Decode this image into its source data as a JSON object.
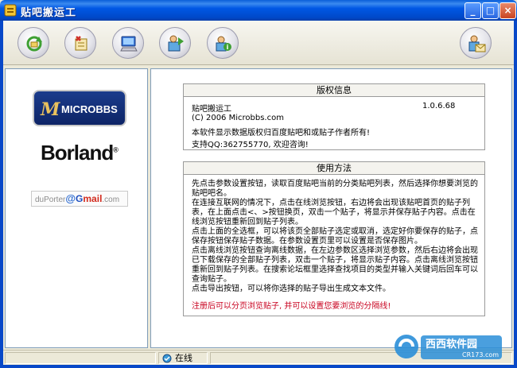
{
  "window": {
    "title": "贴吧搬运工",
    "minimize_symbol": "_",
    "maximize_symbol": "□",
    "close_symbol": "×"
  },
  "toolbar": {
    "buttons": [
      {
        "name": "refresh-button",
        "icon": "refresh-icon"
      },
      {
        "name": "delete-button",
        "icon": "delete-icon"
      },
      {
        "name": "computer-button",
        "icon": "computer-icon"
      },
      {
        "name": "export-button",
        "icon": "export-icon"
      },
      {
        "name": "info-button",
        "icon": "info-icon"
      },
      {
        "name": "contact-button",
        "icon": "user-mail-icon"
      }
    ]
  },
  "left_panel": {
    "microbbs_mark": "M",
    "microbbs_word": "MICROBBS",
    "borland": "Borland",
    "borland_reg": "®",
    "gmail_user": "duPorter",
    "gmail_at": "@",
    "gmail_g": "G",
    "gmail_mail": "mail",
    "gmail_com": ".com"
  },
  "copyright": {
    "header": "版权信息",
    "app_name": "贴吧搬运工",
    "version": "1.0.6.68",
    "copyright_line": "(C) 2006 Microbbs.com",
    "notice": "本软件显示数据版权归百度贴吧和或贴子作者所有!",
    "support": "支持QQ:362755770, 欢迎咨询!"
  },
  "usage": {
    "header": "使用方法",
    "body": "先点击参数设置按钮，读取百度贴吧当前的分类贴吧列表，然后选择你想要浏览的贴吧吧名。\n在连接互联网的情况下，点击在线浏览按钮，右边将会出现该贴吧首页的贴子列表，在上面点击<、>按钮换页，双击一个贴子，将显示并保存贴子内容。点击在线浏览按钮重新回到贴子列表。\n点击上面的全选框，可以将该页全部贴子选定或取消，选定好你要保存的贴子，点保存按钮保存贴子数据。在参数设置页里可以设置是否保存图片。\n点击离线浏览按钮查询离线数据，在左边参数区选择浏览参数，然后右边将会出现已下载保存的全部贴子列表，双击一个贴子，将显示贴子内容。点击离线浏览按钮重新回到贴子列表。在搜索论坛框里选择查找项目的类型并输入关键词后回车可以查询贴子。\n点击导出按钮，可以将你选择的贴子导出生成文本文件。",
    "warning": "注册后可以分页浏览贴子, 并可以设置您要浏览的分隔线!"
  },
  "statusbar": {
    "online": "在线"
  },
  "watermark": {
    "brand": "西西软件园",
    "domain": "CR173.com"
  }
}
